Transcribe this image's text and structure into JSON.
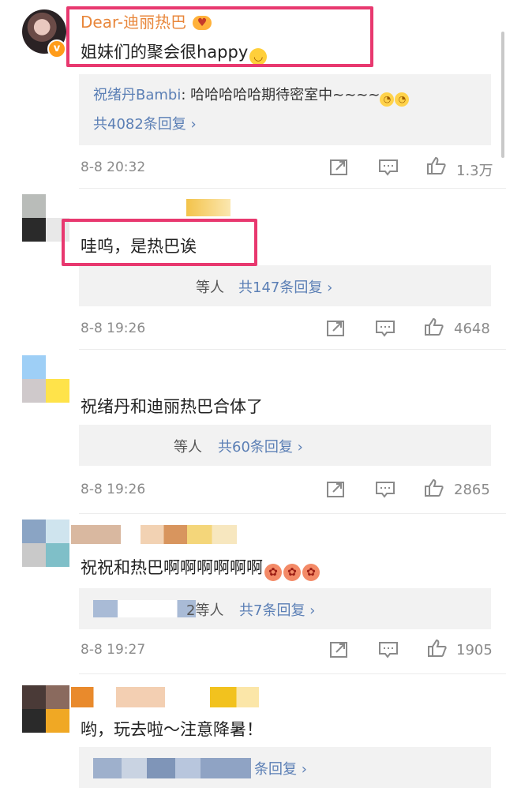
{
  "comments": [
    {
      "username": "Dear-迪丽热巴",
      "text": "姐妹们的聚会很happy",
      "reply_preview": {
        "author": "祝绪丹Bambi",
        "text": "哈哈哈哈哈期待密室中~~~~"
      },
      "reply_count": "共4082条回复 ›",
      "time": "8-8 20:32",
      "likes": "1.3万"
    },
    {
      "text": "哇呜，是热巴诶",
      "reply_people": "等人",
      "reply_count": "共147条回复 ›",
      "time": "8-8 19:26",
      "likes": "4648"
    },
    {
      "text": "祝绪丹和迪丽热巴合体了",
      "reply_people": "等人",
      "reply_count": "共60条回复 ›",
      "time": "8-8 19:26",
      "likes": "2865"
    },
    {
      "text": "祝祝和热巴啊啊啊啊啊啊",
      "reply_people": "2等人",
      "reply_count": "共7条回复 ›",
      "time": "8-8 19:27",
      "likes": "1905"
    },
    {
      "text": "哟，玩去啦～注意降暑！",
      "reply_count": "条回复 ›"
    }
  ],
  "icons": {
    "vip": "v",
    "repost": "repost-icon",
    "comment": "comment-icon",
    "like": "like-icon"
  },
  "colors": {
    "highlight": "#e8386f",
    "link": "#5b7fb5",
    "username": "#e8863a",
    "meta": "#8a8a8a"
  }
}
